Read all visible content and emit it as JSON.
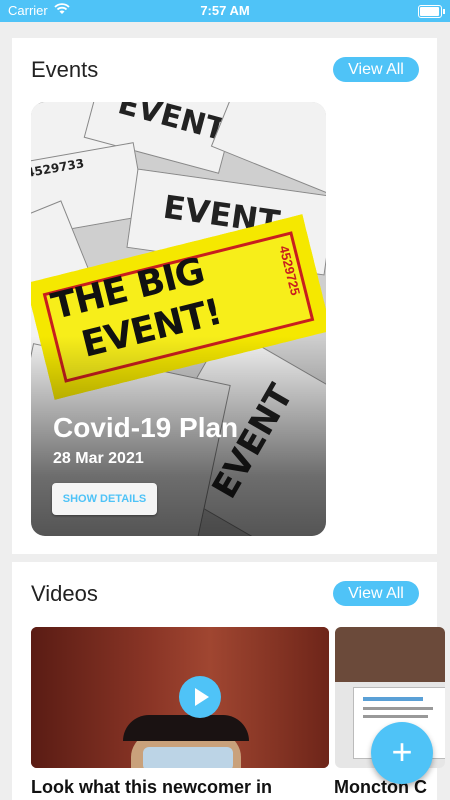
{
  "status_bar": {
    "carrier": "Carrier",
    "time": "7:57 AM"
  },
  "events": {
    "title": "Events",
    "view_all": "View All",
    "item": {
      "ticket_line1": "THE BIG",
      "ticket_line2": "EVENT!",
      "ticket_number": "4529725",
      "bg_ticket_text": "EVENT",
      "bg_ticket_number": "4529733",
      "title": "Covid-19 Plan",
      "date": "28 Mar 2021",
      "button": "SHOW DETAILS"
    }
  },
  "videos": {
    "title": "Videos",
    "view_all": "View All",
    "items": [
      {
        "title": "Look what this newcomer in"
      },
      {
        "title": "Moncton C"
      }
    ]
  },
  "fab": {
    "label": "+"
  },
  "colors": {
    "accent": "#4fc3f7",
    "ticket_yellow": "#f5e800",
    "ticket_red": "#c81e1e"
  }
}
